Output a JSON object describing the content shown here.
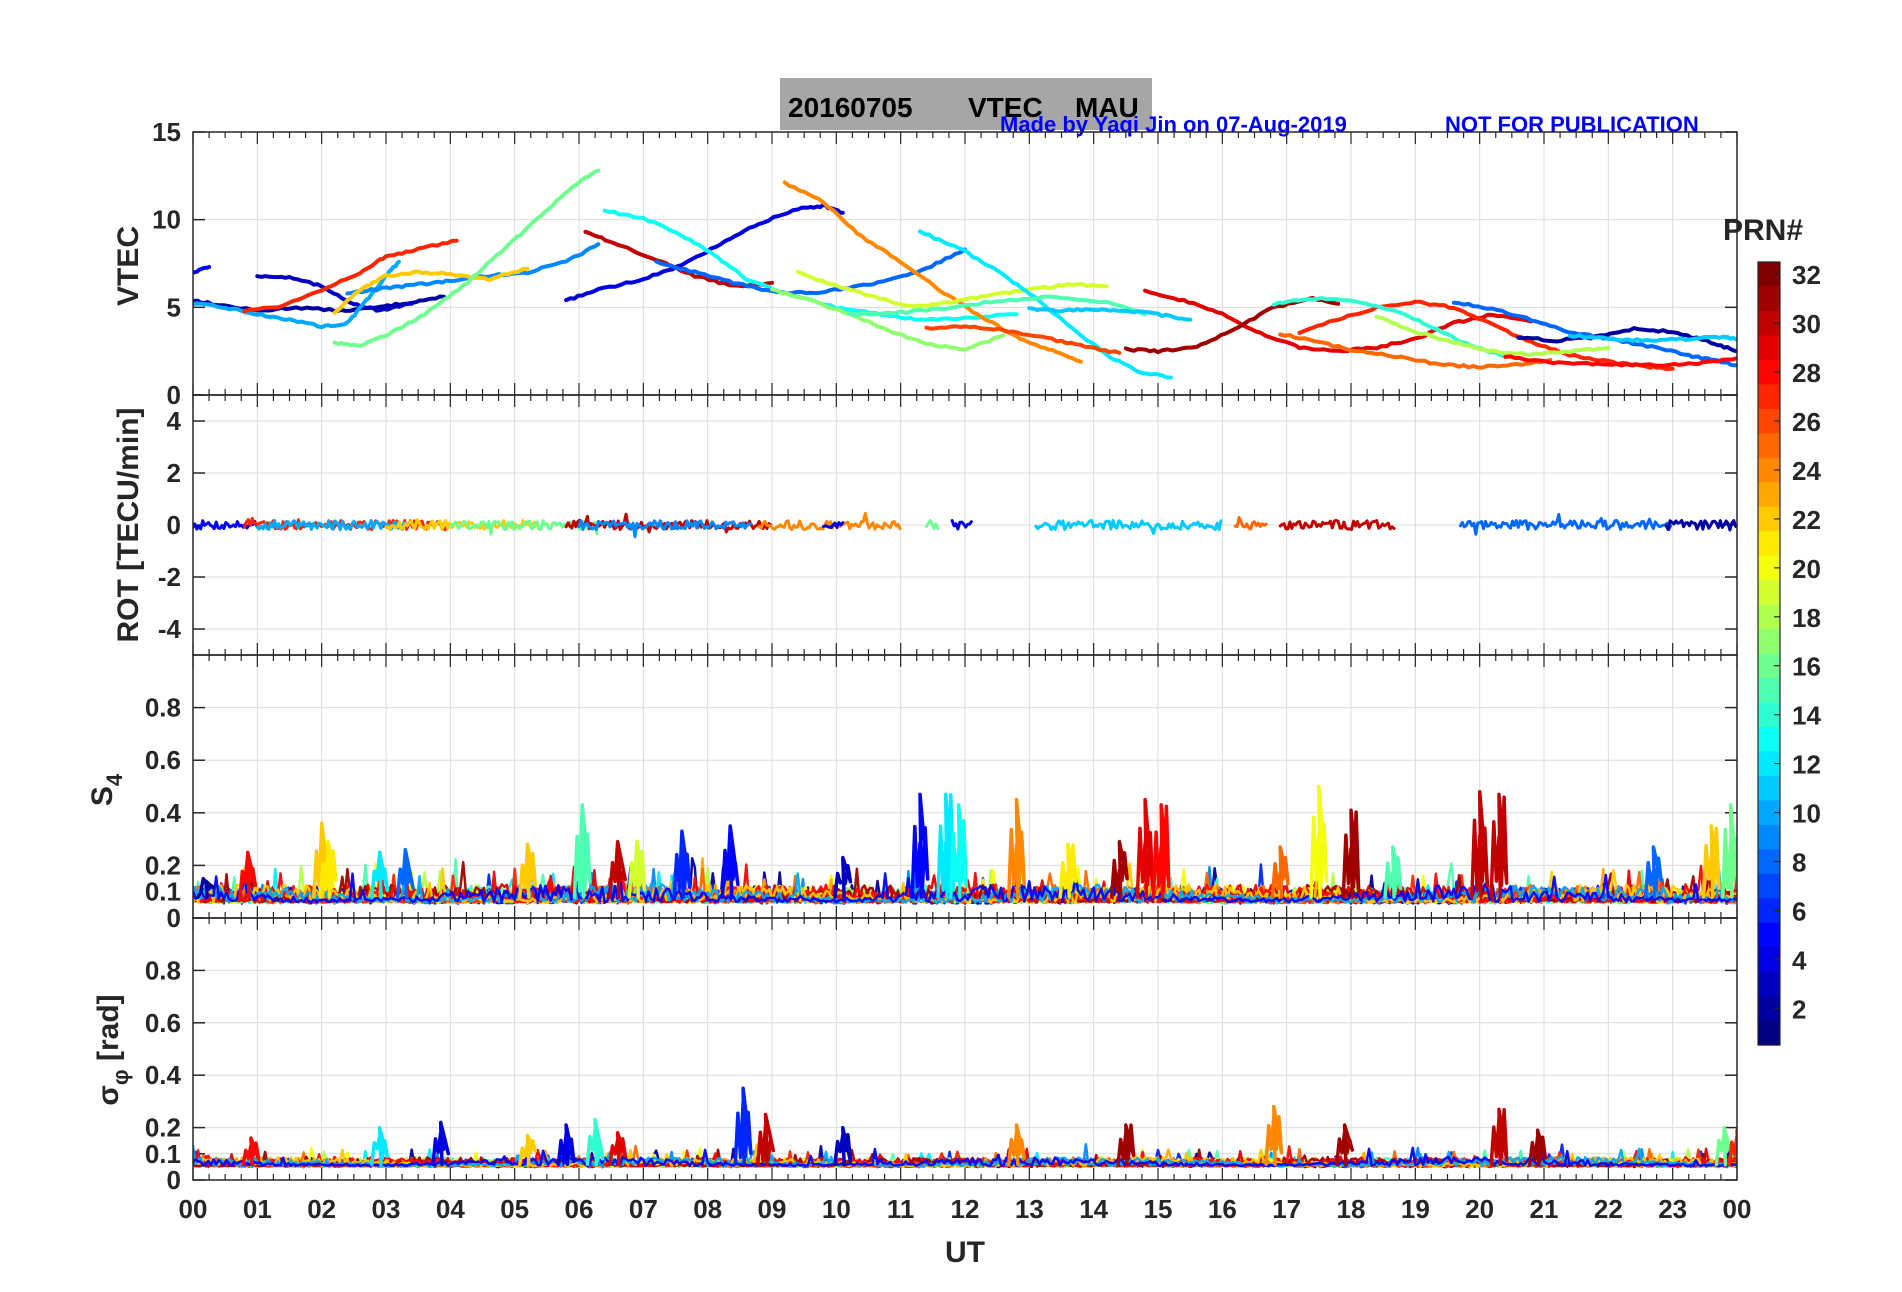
{
  "title": {
    "date": "20160705",
    "product": "VTEC",
    "station": "MAU",
    "box_color": "#a6a6a6"
  },
  "credit": {
    "made_by": "Made by Yaqi Jin on 07-Aug-2019",
    "notice": "NOT FOR PUBLICATION",
    "color": "#0000ff"
  },
  "colorbar": {
    "label": "PRN#",
    "range": [
      1,
      32
    ],
    "ticks": [
      "2",
      "4",
      "6",
      "8",
      "10",
      "12",
      "14",
      "16",
      "18",
      "20",
      "22",
      "24",
      "26",
      "28",
      "30",
      "32"
    ],
    "colormap": "jet"
  },
  "chart_data": [
    {
      "type": "line",
      "panel": "vtec",
      "ylabel": "VTEC",
      "ylim": [
        0,
        15
      ],
      "yticks": [
        "0",
        "5",
        "10",
        "15"
      ],
      "grid": true,
      "series": [
        {
          "prn": 2,
          "x": [
            0.0,
            0.3,
            1.0,
            1.6,
            2.3,
            2.9,
            3.4,
            3.9
          ],
          "y": [
            5.4,
            5.2,
            4.8,
            5.0,
            4.8,
            5.0,
            5.3,
            5.6
          ]
        },
        {
          "prn": 5,
          "x": [
            0.0,
            0.25
          ],
          "y": [
            7.0,
            7.3
          ]
        },
        {
          "prn": 3,
          "x": [
            1.0,
            1.5,
            2.0,
            2.5,
            2.9,
            3.4
          ],
          "y": [
            6.8,
            6.7,
            6.2,
            5.2,
            4.8,
            5.2
          ]
        },
        {
          "prn": 10,
          "x": [
            0.0,
            0.5,
            1.0,
            1.5,
            2.0,
            2.4,
            2.7,
            3.0,
            3.2
          ],
          "y": [
            5.2,
            5.0,
            4.6,
            4.3,
            3.9,
            4.1,
            5.4,
            6.8,
            7.6
          ]
        },
        {
          "prn": 27,
          "x": [
            0.8,
            1.4,
            2.0,
            2.6,
            3.0,
            3.5,
            4.1
          ],
          "y": [
            4.8,
            5.1,
            6.0,
            7.0,
            7.9,
            8.3,
            8.8
          ]
        },
        {
          "prn": 9,
          "x": [
            2.4,
            3.0,
            3.5,
            4.0,
            4.6,
            5.2,
            5.8,
            6.3
          ],
          "y": [
            5.8,
            6.1,
            6.3,
            6.5,
            6.8,
            7.0,
            7.6,
            8.6
          ]
        },
        {
          "prn": 22,
          "x": [
            2.2,
            2.6,
            3.0,
            3.5,
            4.0,
            4.6,
            5.2
          ],
          "y": [
            4.7,
            6.0,
            6.8,
            7.0,
            6.9,
            6.6,
            7.2
          ]
        },
        {
          "prn": 16,
          "x": [
            2.2,
            2.6,
            3.1,
            3.6,
            4.2,
            4.8,
            5.4,
            5.9,
            6.3
          ],
          "y": [
            3.0,
            2.8,
            3.6,
            4.6,
            6.2,
            8.2,
            10.2,
            11.9,
            12.8
          ]
        },
        {
          "prn": 4,
          "x": [
            5.8,
            6.3,
            7.0,
            7.6,
            8.2,
            8.8,
            9.4,
            9.8,
            10.1
          ],
          "y": [
            5.4,
            6.0,
            6.6,
            7.4,
            8.6,
            9.8,
            10.6,
            10.8,
            10.4
          ]
        },
        {
          "prn": 30,
          "x": [
            6.1,
            6.6,
            7.2,
            7.8,
            8.4,
            9.0
          ],
          "y": [
            9.3,
            8.6,
            7.7,
            6.8,
            6.2,
            6.4
          ]
        },
        {
          "prn": 13,
          "x": [
            6.4,
            7.0,
            7.6,
            8.1,
            8.6,
            9.3,
            10.0,
            10.7,
            11.3,
            12.0,
            12.8
          ],
          "y": [
            10.5,
            10.1,
            9.1,
            8.0,
            6.6,
            5.7,
            5.0,
            4.6,
            4.3,
            4.4,
            4.6
          ]
        },
        {
          "prn": 8,
          "x": [
            7.2,
            7.8,
            8.4,
            9.0,
            9.6,
            10.2,
            10.8,
            11.4,
            12.0
          ],
          "y": [
            7.6,
            7.0,
            6.4,
            5.9,
            5.8,
            6.1,
            6.5,
            7.2,
            8.3
          ]
        },
        {
          "prn": 24,
          "x": [
            9.2,
            9.8,
            10.4,
            11.0,
            11.6,
            12.2,
            12.8,
            13.3,
            13.8
          ],
          "y": [
            12.1,
            11.0,
            9.0,
            7.6,
            6.0,
            4.6,
            3.3,
            2.6,
            1.9
          ]
        },
        {
          "prn": 17,
          "x": [
            9.0,
            9.6,
            10.2,
            10.8,
            11.4,
            12.0,
            12.6
          ],
          "y": [
            6.0,
            5.4,
            4.6,
            3.7,
            2.9,
            2.6,
            3.4
          ]
        },
        {
          "prn": 19,
          "x": [
            9.4,
            10.0,
            10.6,
            11.2,
            11.8,
            12.4,
            13.0,
            13.6,
            14.2
          ],
          "y": [
            7.0,
            6.2,
            5.6,
            5.0,
            5.3,
            5.7,
            6.0,
            6.3,
            6.2
          ]
        },
        {
          "prn": 12,
          "x": [
            11.3,
            11.9,
            12.5,
            13.0,
            13.6,
            14.2,
            14.7,
            15.2
          ],
          "y": [
            9.3,
            8.4,
            7.1,
            5.8,
            4.0,
            2.3,
            1.3,
            1.0
          ]
        },
        {
          "prn": 26,
          "x": [
            11.4,
            12.0,
            12.6,
            13.2,
            13.8,
            14.4
          ],
          "y": [
            3.8,
            3.9,
            3.7,
            3.3,
            2.8,
            2.4
          ]
        },
        {
          "prn": 15,
          "x": [
            10.2,
            11.0,
            11.8,
            12.6,
            13.4,
            14.2,
            14.8
          ],
          "y": [
            4.6,
            4.7,
            5.0,
            5.4,
            5.6,
            5.3,
            4.6
          ]
        },
        {
          "prn": 11,
          "x": [
            13.0,
            13.5,
            14.0,
            14.5,
            15.0,
            15.5
          ],
          "y": [
            4.9,
            4.8,
            4.9,
            4.8,
            4.6,
            4.3
          ]
        },
        {
          "prn": 29,
          "x": [
            14.8,
            15.4,
            16.0,
            16.6,
            17.2,
            17.8,
            18.4,
            19.0,
            19.6,
            20.2,
            20.8
          ],
          "y": [
            5.9,
            5.4,
            4.6,
            3.5,
            2.7,
            2.5,
            2.7,
            3.2,
            4.1,
            4.6,
            4.2
          ]
        },
        {
          "prn": 31,
          "x": [
            14.5,
            15.0,
            15.6,
            16.2,
            16.8,
            17.4,
            17.8
          ],
          "y": [
            2.6,
            2.5,
            2.7,
            3.8,
            5.0,
            5.5,
            5.2
          ]
        },
        {
          "prn": 27,
          "x": [
            17.2,
            17.8,
            18.4,
            19.0,
            19.6,
            20.2,
            20.8,
            21.4,
            22.0,
            22.6,
            23.0
          ],
          "y": [
            3.6,
            4.3,
            5.0,
            5.3,
            5.0,
            4.0,
            3.0,
            2.3,
            1.9,
            1.6,
            1.5
          ]
        },
        {
          "prn": 25,
          "x": [
            16.9,
            17.5,
            18.1,
            18.7,
            19.3,
            19.9,
            20.5,
            21.1
          ],
          "y": [
            3.5,
            3.0,
            2.5,
            2.2,
            1.8,
            1.6,
            1.7,
            2.0
          ]
        },
        {
          "prn": 14,
          "x": [
            16.8,
            17.4,
            18.0,
            18.6,
            19.2,
            19.8,
            20.4
          ],
          "y": [
            5.2,
            5.5,
            5.4,
            4.9,
            4.0,
            2.9,
            2.2
          ]
        },
        {
          "prn": 18,
          "x": [
            18.4,
            19.0,
            19.6,
            20.2,
            20.8,
            21.4,
            22.0
          ],
          "y": [
            4.5,
            3.6,
            3.0,
            2.5,
            2.3,
            2.5,
            2.7
          ]
        },
        {
          "prn": 8,
          "x": [
            19.6,
            20.2,
            20.8,
            21.4,
            22.0,
            22.6,
            23.2,
            23.6,
            24.0
          ],
          "y": [
            5.3,
            4.9,
            4.3,
            3.6,
            3.2,
            2.8,
            2.3,
            2.0,
            1.7
          ]
        },
        {
          "prn": 2,
          "x": [
            20.6,
            21.2,
            21.8,
            22.4,
            23.0,
            23.6,
            24.0
          ],
          "y": [
            3.3,
            3.1,
            3.3,
            3.8,
            3.6,
            3.0,
            2.5
          ]
        },
        {
          "prn": 11,
          "x": [
            21.4,
            22.0,
            22.6,
            23.2,
            23.8,
            24.0
          ],
          "y": [
            3.4,
            3.2,
            3.1,
            3.2,
            3.3,
            3.2
          ]
        },
        {
          "prn": 28,
          "x": [
            20.4,
            21.0,
            21.6,
            22.2,
            22.8,
            23.4,
            24.0
          ],
          "y": [
            2.2,
            1.9,
            1.8,
            1.7,
            1.7,
            1.8,
            2.1
          ]
        }
      ]
    },
    {
      "type": "line",
      "panel": "rot",
      "ylabel": "ROT [TECU/min]",
      "ylim": [
        -5,
        5
      ],
      "yticks": [
        "-4",
        "-2",
        "0",
        "2",
        "4"
      ],
      "grid": true,
      "segments": [
        {
          "prn": 5,
          "x": [
            0.0,
            1.0
          ]
        },
        {
          "prn": 27,
          "x": [
            0.8,
            4.0
          ]
        },
        {
          "prn": 10,
          "x": [
            1.0,
            3.3
          ]
        },
        {
          "prn": 22,
          "x": [
            3.0,
            5.4
          ]
        },
        {
          "prn": 16,
          "x": [
            4.0,
            6.3
          ]
        },
        {
          "prn": 30,
          "x": [
            5.8,
            9.0
          ]
        },
        {
          "prn": 9,
          "x": [
            6.0,
            8.7
          ]
        },
        {
          "prn": 24,
          "x": [
            8.8,
            11.0
          ]
        },
        {
          "prn": 4,
          "x": [
            9.8,
            10.1
          ]
        },
        {
          "prn": 16,
          "x": [
            11.4,
            11.6
          ]
        },
        {
          "prn": 4,
          "x": [
            11.8,
            12.1
          ]
        },
        {
          "prn": 11,
          "x": [
            13.1,
            16.0
          ]
        },
        {
          "prn": 25,
          "x": [
            16.2,
            16.7
          ]
        },
        {
          "prn": 30,
          "x": [
            16.9,
            18.7
          ]
        },
        {
          "prn": 8,
          "x": [
            19.7,
            23.0
          ]
        },
        {
          "prn": 2,
          "x": [
            22.9,
            24.0
          ]
        }
      ]
    },
    {
      "type": "line",
      "panel": "s4",
      "ylabel": "S",
      "ylabel_sub": "4",
      "ylim": [
        0,
        1
      ],
      "yticks": [
        "0",
        "0.1",
        "0.2",
        "0.4",
        "0.6",
        "0.8"
      ],
      "grid": true,
      "spikes": [
        {
          "prn": 2,
          "x": 0.2,
          "y": 0.14
        },
        {
          "prn": 28,
          "x": 0.85,
          "y": 0.25
        },
        {
          "prn": 22,
          "x": 2.0,
          "y": 0.36
        },
        {
          "prn": 21,
          "x": 2.1,
          "y": 0.29
        },
        {
          "prn": 12,
          "x": 2.9,
          "y": 0.25
        },
        {
          "prn": 8,
          "x": 3.3,
          "y": 0.26
        },
        {
          "prn": 22,
          "x": 5.2,
          "y": 0.28
        },
        {
          "prn": 15,
          "x": 6.05,
          "y": 0.43
        },
        {
          "prn": 30,
          "x": 6.6,
          "y": 0.29
        },
        {
          "prn": 19,
          "x": 6.9,
          "y": 0.29
        },
        {
          "prn": 6,
          "x": 7.6,
          "y": 0.33
        },
        {
          "prn": 5,
          "x": 8.35,
          "y": 0.35
        },
        {
          "prn": 3,
          "x": 10.1,
          "y": 0.23
        },
        {
          "prn": 5,
          "x": 11.3,
          "y": 0.47
        },
        {
          "prn": 12,
          "x": 11.7,
          "y": 0.47
        },
        {
          "prn": 13,
          "x": 11.9,
          "y": 0.43
        },
        {
          "prn": 24,
          "x": 12.8,
          "y": 0.45
        },
        {
          "prn": 21,
          "x": 13.6,
          "y": 0.28
        },
        {
          "prn": 31,
          "x": 14.4,
          "y": 0.29
        },
        {
          "prn": 29,
          "x": 14.8,
          "y": 0.45
        },
        {
          "prn": 28,
          "x": 15.05,
          "y": 0.43
        },
        {
          "prn": 25,
          "x": 16.9,
          "y": 0.27
        },
        {
          "prn": 20,
          "x": 17.5,
          "y": 0.5
        },
        {
          "prn": 31,
          "x": 18.0,
          "y": 0.41
        },
        {
          "prn": 15,
          "x": 18.65,
          "y": 0.27
        },
        {
          "prn": 30,
          "x": 20.0,
          "y": 0.48
        },
        {
          "prn": 30,
          "x": 20.3,
          "y": 0.47
        },
        {
          "prn": 8,
          "x": 22.7,
          "y": 0.27
        },
        {
          "prn": 16,
          "x": 23.9,
          "y": 0.43
        },
        {
          "prn": 22,
          "x": 23.6,
          "y": 0.35
        }
      ]
    },
    {
      "type": "line",
      "panel": "sigma_phi",
      "ylabel": "σ",
      "ylabel_sub": "φ",
      "ylabel_suffix": " [rad]",
      "ylim": [
        0,
        1
      ],
      "yticks": [
        "0",
        "0.1",
        "0.2",
        "0.4",
        "0.6",
        "0.8"
      ],
      "grid": true,
      "spikes": [
        {
          "prn": 28,
          "x": 0.9,
          "y": 0.16
        },
        {
          "prn": 12,
          "x": 2.9,
          "y": 0.2
        },
        {
          "prn": 4,
          "x": 3.85,
          "y": 0.22
        },
        {
          "prn": 22,
          "x": 5.2,
          "y": 0.17
        },
        {
          "prn": 4,
          "x": 5.8,
          "y": 0.21
        },
        {
          "prn": 14,
          "x": 6.25,
          "y": 0.23
        },
        {
          "prn": 29,
          "x": 6.6,
          "y": 0.18
        },
        {
          "prn": 6,
          "x": 8.55,
          "y": 0.35
        },
        {
          "prn": 30,
          "x": 8.9,
          "y": 0.25
        },
        {
          "prn": 3,
          "x": 10.1,
          "y": 0.2
        },
        {
          "prn": 24,
          "x": 12.8,
          "y": 0.21
        },
        {
          "prn": 31,
          "x": 14.5,
          "y": 0.21
        },
        {
          "prn": 24,
          "x": 16.8,
          "y": 0.28
        },
        {
          "prn": 31,
          "x": 17.9,
          "y": 0.21
        },
        {
          "prn": 30,
          "x": 20.3,
          "y": 0.27
        },
        {
          "prn": 31,
          "x": 20.9,
          "y": 0.19
        },
        {
          "prn": 16,
          "x": 23.8,
          "y": 0.2
        },
        {
          "prn": 27,
          "x": 24.0,
          "y": 0.19
        }
      ]
    }
  ],
  "xaxis": {
    "label": "UT",
    "xlim": [
      0,
      24
    ],
    "ticks": [
      "00",
      "01",
      "02",
      "03",
      "04",
      "05",
      "06",
      "07",
      "08",
      "09",
      "10",
      "11",
      "12",
      "13",
      "14",
      "15",
      "16",
      "17",
      "18",
      "19",
      "20",
      "21",
      "22",
      "23",
      "00"
    ]
  }
}
